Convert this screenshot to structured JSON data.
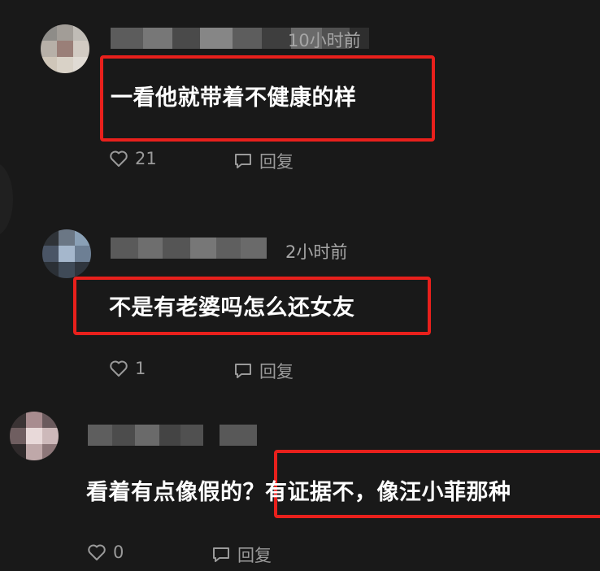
{
  "comments": [
    {
      "time": "10小时前",
      "text": "一看他就带着不健康的样",
      "likes": "21",
      "reply_label": "回复",
      "like_icon": "heart-icon",
      "reply_icon": "comment-bubble-icon"
    },
    {
      "time": "2小时前",
      "text": "不是有老婆吗怎么还女友",
      "likes": "1",
      "reply_label": "回复",
      "like_icon": "heart-icon",
      "reply_icon": "comment-bubble-icon"
    },
    {
      "time": "",
      "text": "看着有点像假的？有证据不，像汪小菲那种",
      "likes": "0",
      "reply_label": "回复",
      "like_icon": "heart-icon",
      "reply_icon": "comment-bubble-icon"
    }
  ],
  "colors": {
    "background": "#191919",
    "highlight_box": "#e8201c",
    "meta_text": "#a6a6a6"
  }
}
